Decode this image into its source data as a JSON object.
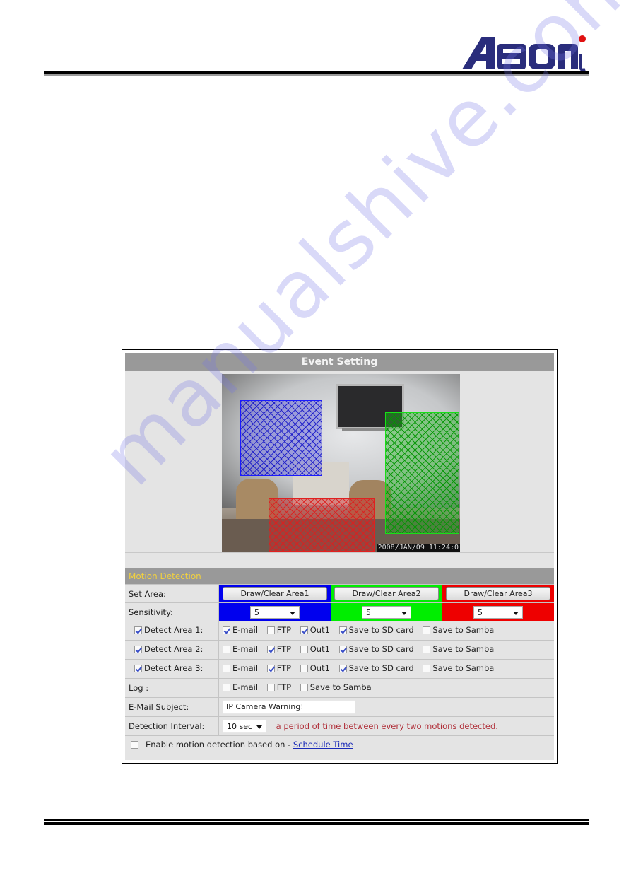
{
  "brand": {
    "name": "Asoni",
    "color": "#2a2d7c",
    "dot_color": "#e01010"
  },
  "watermark": "manualshive.com",
  "panel": {
    "title": "Event Setting",
    "camera": {
      "timestamp": "2008/JAN/09 11:24:0"
    },
    "section_title": "Motion Detection",
    "area_colors": [
      "#0000ee",
      "#00ee00",
      "#ee0000"
    ],
    "rows": {
      "set_area": {
        "label": "Set Area:",
        "buttons": [
          "Draw/Clear Area1",
          "Draw/Clear Area2",
          "Draw/Clear Area3"
        ]
      },
      "sensitivity": {
        "label": "Sensitivity:",
        "values": [
          "5",
          "5",
          "5"
        ]
      },
      "detect_areas": [
        {
          "label": "Detect Area 1:",
          "checked": true,
          "options": [
            {
              "label": "E-mail",
              "checked": true
            },
            {
              "label": "FTP",
              "checked": false
            },
            {
              "label": "Out1",
              "checked": true
            },
            {
              "label": "Save to SD card",
              "checked": true
            },
            {
              "label": "Save to Samba",
              "checked": false
            }
          ]
        },
        {
          "label": "Detect Area 2:",
          "checked": true,
          "options": [
            {
              "label": "E-mail",
              "checked": false
            },
            {
              "label": "FTP",
              "checked": true
            },
            {
              "label": "Out1",
              "checked": false
            },
            {
              "label": "Save to SD card",
              "checked": true
            },
            {
              "label": "Save to Samba",
              "checked": false
            }
          ]
        },
        {
          "label": "Detect Area 3:",
          "checked": true,
          "options": [
            {
              "label": "E-mail",
              "checked": false
            },
            {
              "label": "FTP",
              "checked": true
            },
            {
              "label": "Out1",
              "checked": false
            },
            {
              "label": "Save to SD card",
              "checked": true
            },
            {
              "label": "Save to Samba",
              "checked": false
            }
          ]
        }
      ],
      "log": {
        "label": "Log :",
        "options": [
          {
            "label": "E-mail",
            "checked": false
          },
          {
            "label": "FTP",
            "checked": false
          },
          {
            "label": "Save to Samba",
            "checked": false
          }
        ]
      },
      "email_subject": {
        "label": "E-Mail Subject:",
        "value": "IP Camera Warning!"
      },
      "detection_interval": {
        "label": "Detection Interval:",
        "value": "10 sec",
        "hint": "a period of time between every two motions detected."
      },
      "schedule": {
        "checked": false,
        "label": "Enable motion detection based on - ",
        "link": "Schedule Time"
      }
    }
  }
}
